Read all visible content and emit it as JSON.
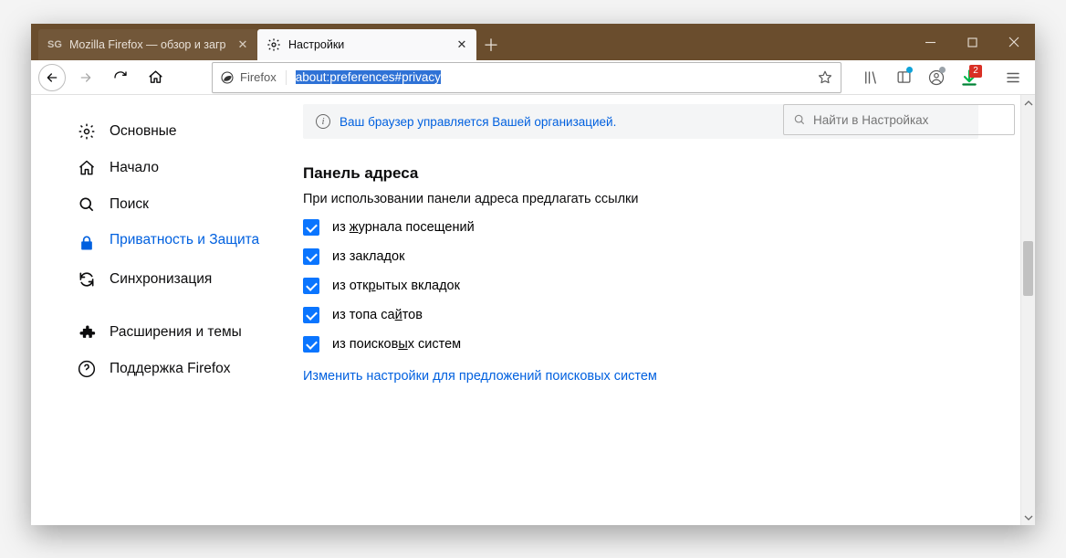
{
  "window": {
    "tabs": [
      {
        "title": "Mozilla Firefox — обзор и загр",
        "active": false
      },
      {
        "title": "Настройки",
        "active": true
      }
    ]
  },
  "urlbar": {
    "identity_label": "Firefox",
    "url_selected": "about:preferences#privacy"
  },
  "toolbar_badge": {
    "download_count": "2"
  },
  "search": {
    "placeholder": "Найти в Настройках"
  },
  "banner": {
    "text": "Ваш браузер управляется Вашей организацией."
  },
  "sidebar": {
    "items": [
      {
        "label": "Основные"
      },
      {
        "label": "Начало"
      },
      {
        "label": "Поиск"
      },
      {
        "label": "Приватность и Защита"
      },
      {
        "label": "Синхронизация"
      }
    ],
    "extra": [
      {
        "label": "Расширения и темы"
      },
      {
        "label": "Поддержка Firefox"
      }
    ]
  },
  "section": {
    "title": "Панель адреса",
    "subtitle": "При использовании панели адреса предлагать ссылки",
    "options": {
      "history_pre": "из ",
      "history_u": "ж",
      "history_post": "урнала посещений",
      "bookmarks_pre": "из закла",
      "bookmarks_u": "д",
      "bookmarks_post": "ок",
      "tabs_pre": "из отк",
      "tabs_u": "р",
      "tabs_post": "ытых вкладок",
      "topsites_pre": "из топа са",
      "topsites_u": "й",
      "topsites_post": "тов",
      "engines_pre": "из поисков",
      "engines_u": "ы",
      "engines_post": "х систем"
    },
    "link": "Изменить настройки для предложений поисковых систем"
  }
}
